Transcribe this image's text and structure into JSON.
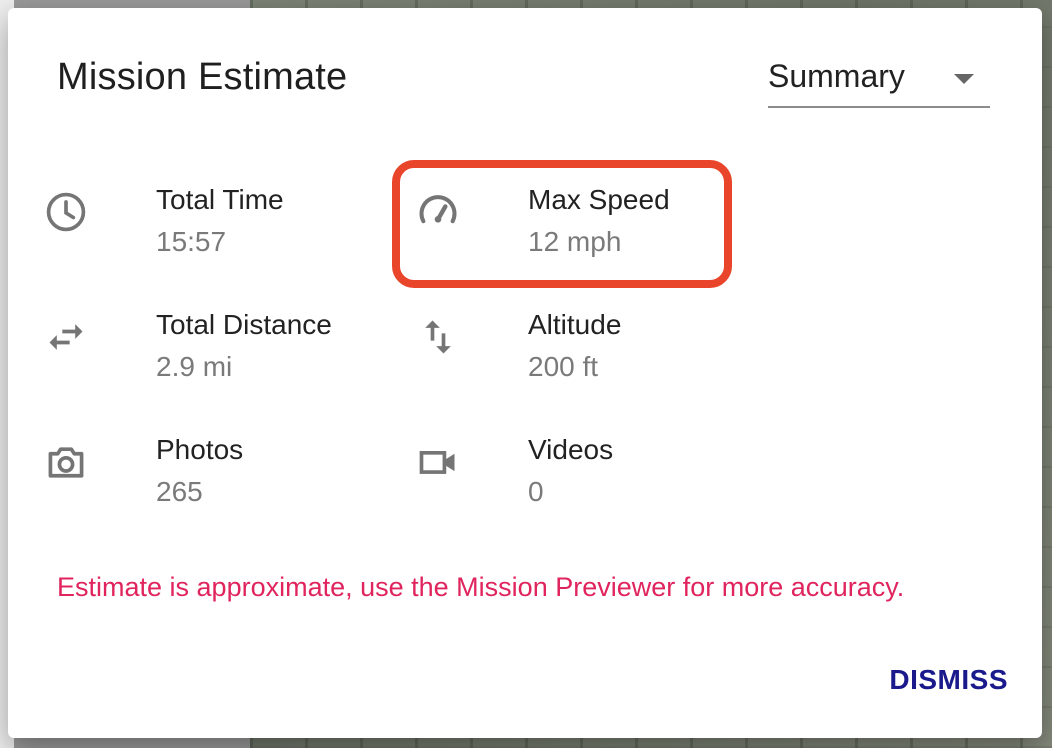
{
  "dialog": {
    "title": "Mission Estimate",
    "view_select": {
      "value": "Summary"
    },
    "stats": {
      "total_time": {
        "label": "Total Time",
        "value": "15:57",
        "icon": "clock-icon"
      },
      "max_speed": {
        "label": "Max Speed",
        "value": "12 mph",
        "icon": "speedometer-icon"
      },
      "total_distance": {
        "label": "Total Distance",
        "value": "2.9 mi",
        "icon": "swap-horizontal-icon"
      },
      "altitude": {
        "label": "Altitude",
        "value": "200 ft",
        "icon": "swap-vertical-icon"
      },
      "photos": {
        "label": "Photos",
        "value": "265",
        "icon": "camera-icon"
      },
      "videos": {
        "label": "Videos",
        "value": "0",
        "icon": "video-camera-icon"
      }
    },
    "note": "Estimate is approximate, use the Mission Previewer for more accuracy.",
    "dismiss_label": "DISMISS"
  },
  "colors": {
    "highlight": "#e8452a",
    "note": "#e0245e",
    "dismiss": "#1a1a8c",
    "icon": "#757575"
  }
}
